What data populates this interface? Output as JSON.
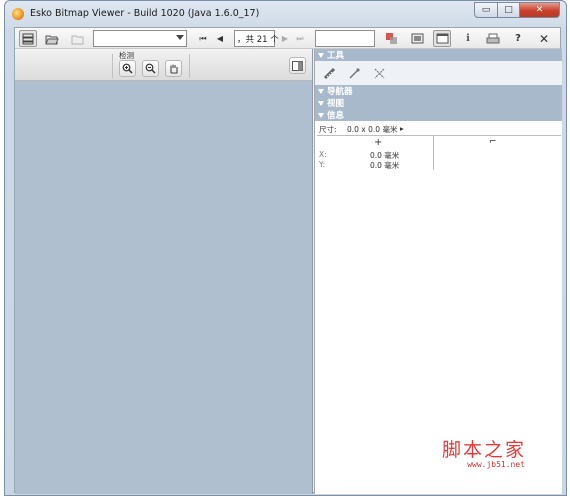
{
  "window": {
    "title": "Esko Bitmap Viewer - Build 1020 (Java 1.6.0_17)",
    "controls": {
      "minimize": "▭",
      "maximize": "□",
      "close": "✕"
    }
  },
  "toolbar": {
    "icons": {
      "layers": "☰",
      "open": "📂",
      "open_disabled": "📂",
      "first": "⏮",
      "prev": "◀",
      "next": "▶",
      "last": "⏭",
      "help": "?",
      "close": "✕",
      "info": "ℹ"
    },
    "file_combo_value": "",
    "page_box_text": "，共 21 个",
    "secondary_field_value": ""
  },
  "view_toolbar": {
    "label": "检测",
    "zoom_in_icon": "🔍",
    "zoom_out_icon": "🔍",
    "pan_icon": "✋",
    "panel_toggle_icon": "▣"
  },
  "side_panel": {
    "sections": {
      "tools": "工具",
      "navigator": "导航器",
      "views": "视图",
      "info": "信息"
    },
    "tools_icons": [
      "ruler-icon",
      "eyedropper-icon",
      "grid-tool-icon"
    ],
    "info": {
      "size_label": "尺寸:",
      "size_value": "0.0 x 0.0 毫米",
      "col_crosshair": "+",
      "col_corner": "⌐",
      "x_label": "X:",
      "x_value": "0.0 毫米",
      "y_label": "Y:",
      "y_value": "0.0 毫米"
    }
  },
  "watermark": {
    "text": "脚本之家",
    "url": "www.jb51.net"
  },
  "colors": {
    "canvas": "#b0bfd0",
    "panel_header": "#a9b9cc",
    "window_frame": "#cdd9e6",
    "close_button": "#c8412c"
  }
}
